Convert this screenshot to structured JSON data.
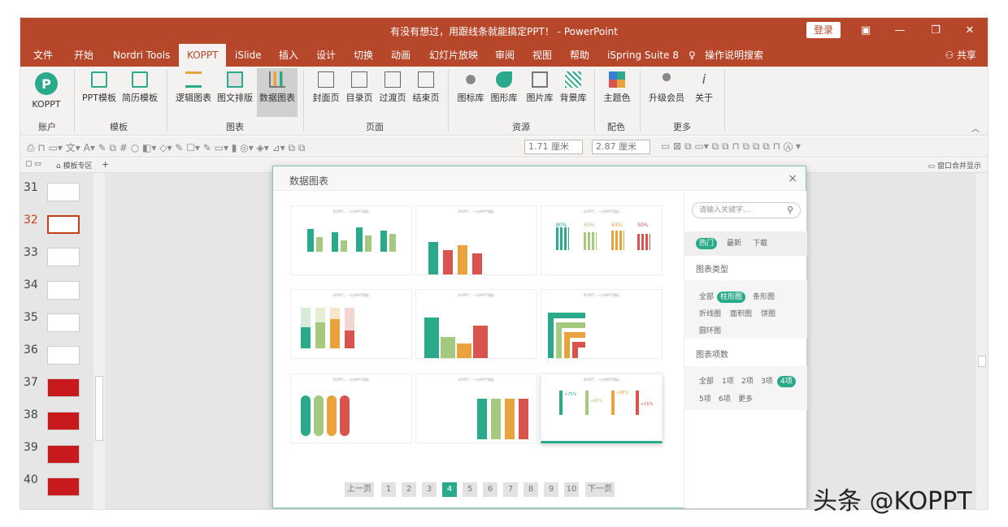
{
  "window": {
    "title": "有没有想过，用跟线条就能搞定PPT！ - PowerPoint",
    "login": "登录",
    "share": "共享"
  },
  "tabs": [
    "文件",
    "开始",
    "Nordri Tools",
    "KOPPT",
    "iSlide",
    "插入",
    "设计",
    "切换",
    "动画",
    "幻灯片放映",
    "审阅",
    "视图",
    "帮助",
    "iSpring Suite 8",
    "操作说明搜索"
  ],
  "active_tab": "KOPPT",
  "ribbon": {
    "buttons": [
      {
        "label": "KOPPT",
        "group": "账户"
      },
      {
        "label": "PPT模板",
        "group": "模板"
      },
      {
        "label": "简历模板",
        "group": "模板"
      },
      {
        "label": "逻辑图表",
        "group": "图表"
      },
      {
        "label": "图文排版",
        "group": "图表"
      },
      {
        "label": "数据图表",
        "group": "图表"
      },
      {
        "label": "封面页",
        "group": "页面"
      },
      {
        "label": "目录页",
        "group": "页面"
      },
      {
        "label": "过渡页",
        "group": "页面"
      },
      {
        "label": "结束页",
        "group": "页面"
      },
      {
        "label": "图标库",
        "group": "资源"
      },
      {
        "label": "图形库",
        "group": "资源"
      },
      {
        "label": "图片库",
        "group": "资源"
      },
      {
        "label": "背景库",
        "group": "资源"
      },
      {
        "label": "主题色",
        "group": "配色"
      },
      {
        "label": "升级会员",
        "group": "更多"
      },
      {
        "label": "关于",
        "group": "更多"
      }
    ],
    "groups": [
      "账户",
      "模板",
      "图表",
      "页面",
      "资源",
      "配色",
      "更多"
    ]
  },
  "toolbar2": {
    "width": "1.71 厘米",
    "height": "2.87 厘米"
  },
  "tabstrip": {
    "tab_label": "模板专区",
    "add": "+",
    "right_label": "窗口合并显示"
  },
  "slides": [
    {
      "num": "31"
    },
    {
      "num": "32"
    },
    {
      "num": "33"
    },
    {
      "num": "34"
    },
    {
      "num": "35"
    },
    {
      "num": "36"
    },
    {
      "num": "37"
    },
    {
      "num": "38"
    },
    {
      "num": "39"
    },
    {
      "num": "40"
    }
  ],
  "current_slide": "32",
  "dialog": {
    "title": "数据图表",
    "close": "×",
    "search_placeholder": "请输入关键字...",
    "sort": [
      "热门",
      "最新",
      "下载"
    ],
    "chart_type_label": "图表类型",
    "chart_types": [
      "全部",
      "柱形图",
      "条形图",
      "折线图",
      "面积图",
      "饼图",
      "圆环图"
    ],
    "count_label": "图表项数",
    "counts": [
      "全部",
      "1项",
      "2项",
      "3项",
      "4项",
      "5项",
      "6项",
      "更多"
    ],
    "card_title": "KOPPT，一分钟PPT模板",
    "pager": [
      "上一页",
      "1",
      "2",
      "3",
      "4",
      "5",
      "6",
      "7",
      "8",
      "9",
      "10",
      "下一页"
    ],
    "current_page": "4",
    "thermo_labels": [
      "+75%",
      "+60%",
      "+86%",
      "+15%"
    ],
    "pct_labels": [
      "80%",
      "60%",
      "64%",
      "50%"
    ]
  },
  "watermark": "头条 @KOPPT",
  "colors": {
    "accent": "#b7472a",
    "green": "#2aaa8a",
    "orange": "#e8a33d",
    "red": "#d9534f"
  }
}
